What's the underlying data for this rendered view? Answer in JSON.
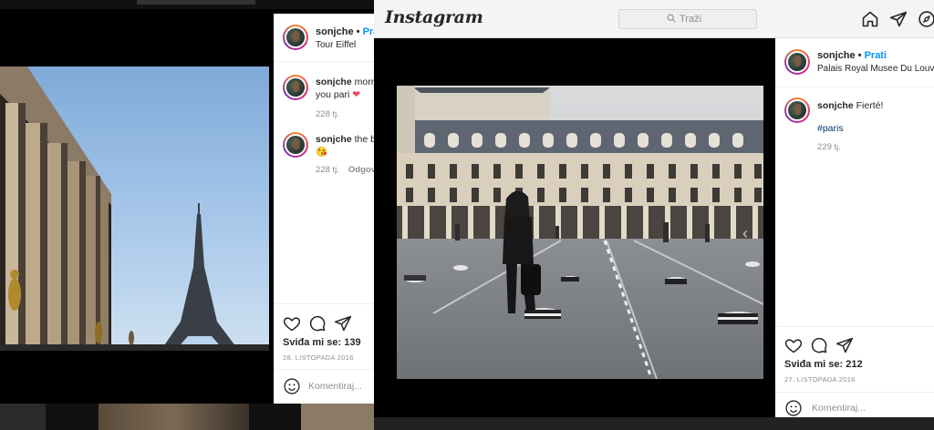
{
  "left_post": {
    "username": "sonjche",
    "follow_label": "Prati",
    "location": "Tour Eiffel",
    "comments": [
      {
        "user": "sonjche",
        "line1": "morni",
        "line2": "you pari",
        "emoji": "❤",
        "time": "228 tj.",
        "reply": ""
      },
      {
        "user": "sonjche",
        "line1": "the b",
        "line2": "",
        "emoji": "😘",
        "time": "228 tj.",
        "reply": "Odgov"
      }
    ],
    "likes": "Sviđa mi se: 139",
    "date": "28. LISTOPADA 2016",
    "add_comment_placeholder": "Komentiraj..."
  },
  "header": {
    "logo": "Instagram",
    "search_placeholder": "Traži",
    "icons": [
      "home-icon",
      "direct-icon",
      "explore-icon"
    ]
  },
  "right_post": {
    "username": "sonjche",
    "follow_label": "Prati",
    "location": "Palais Royal Musee Du Louvre",
    "caption_user": "sonjche",
    "caption_text": "Fierté!",
    "hashtag": "#paris",
    "time": "229 tj.",
    "likes": "Sviđa mi se: 212",
    "date": "27. LISTOPADA 2016",
    "add_comment_placeholder": "Komentiraj..."
  },
  "icons": {
    "like": "heart-icon",
    "comment": "comment-icon",
    "share": "share-icon",
    "emoji": "emoji-icon",
    "prev": "chevron-left-icon"
  }
}
